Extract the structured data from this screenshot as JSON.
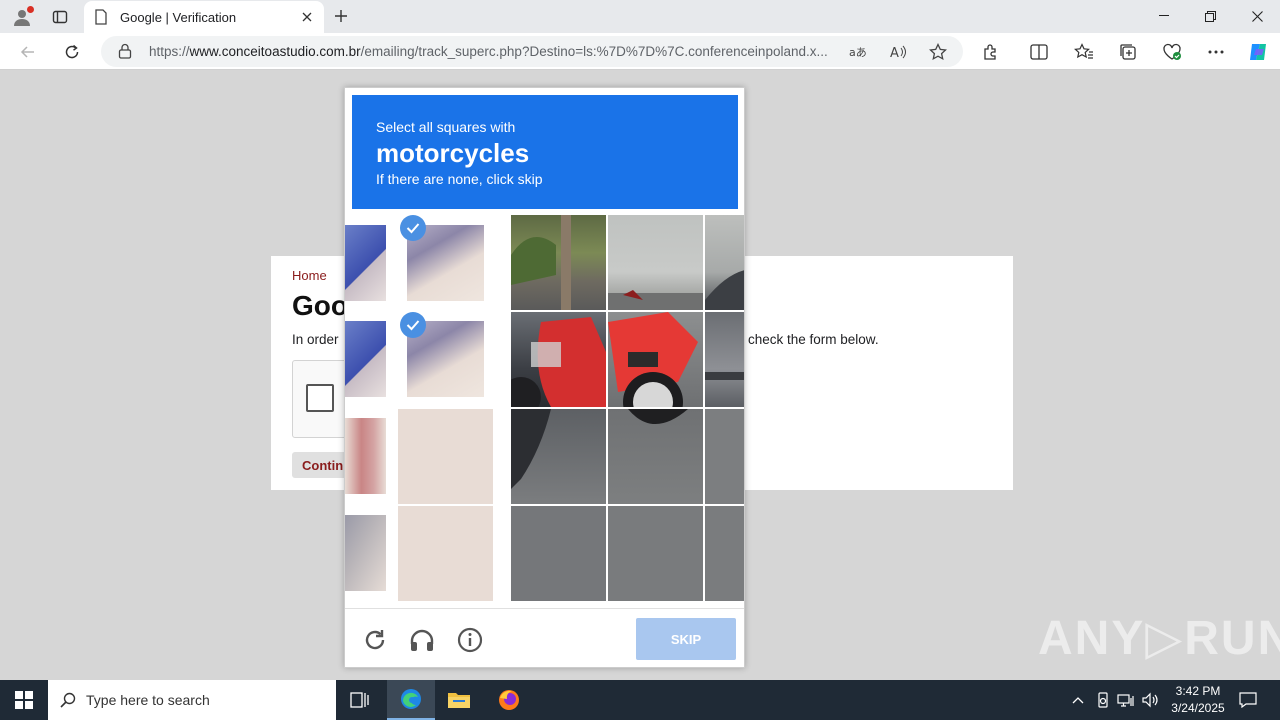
{
  "browser": {
    "tab_title": "Google | Verification",
    "url_prefix": "https://",
    "url_domain": "www.conceitoastudio.com.br",
    "url_path": "/emailing/track_superc.php?Destino=ls:%7D%7D%7C.conferenceinpoland.x..."
  },
  "page": {
    "home_link": "Home",
    "title": "Goo",
    "text_left": "In order",
    "text_right": "check the form below.",
    "continue_label": "Contin"
  },
  "captcha": {
    "instruction_line1": "Select all squares with",
    "target": "motorcycles",
    "instruction_line3": "If there are none, click skip",
    "skip_label": "SKIP",
    "header_color": "#1a73e8"
  },
  "watermark": "ANY▷RUN",
  "taskbar": {
    "search_placeholder": "Type here to search",
    "time": "3:42 PM",
    "date": "3/24/2025"
  }
}
